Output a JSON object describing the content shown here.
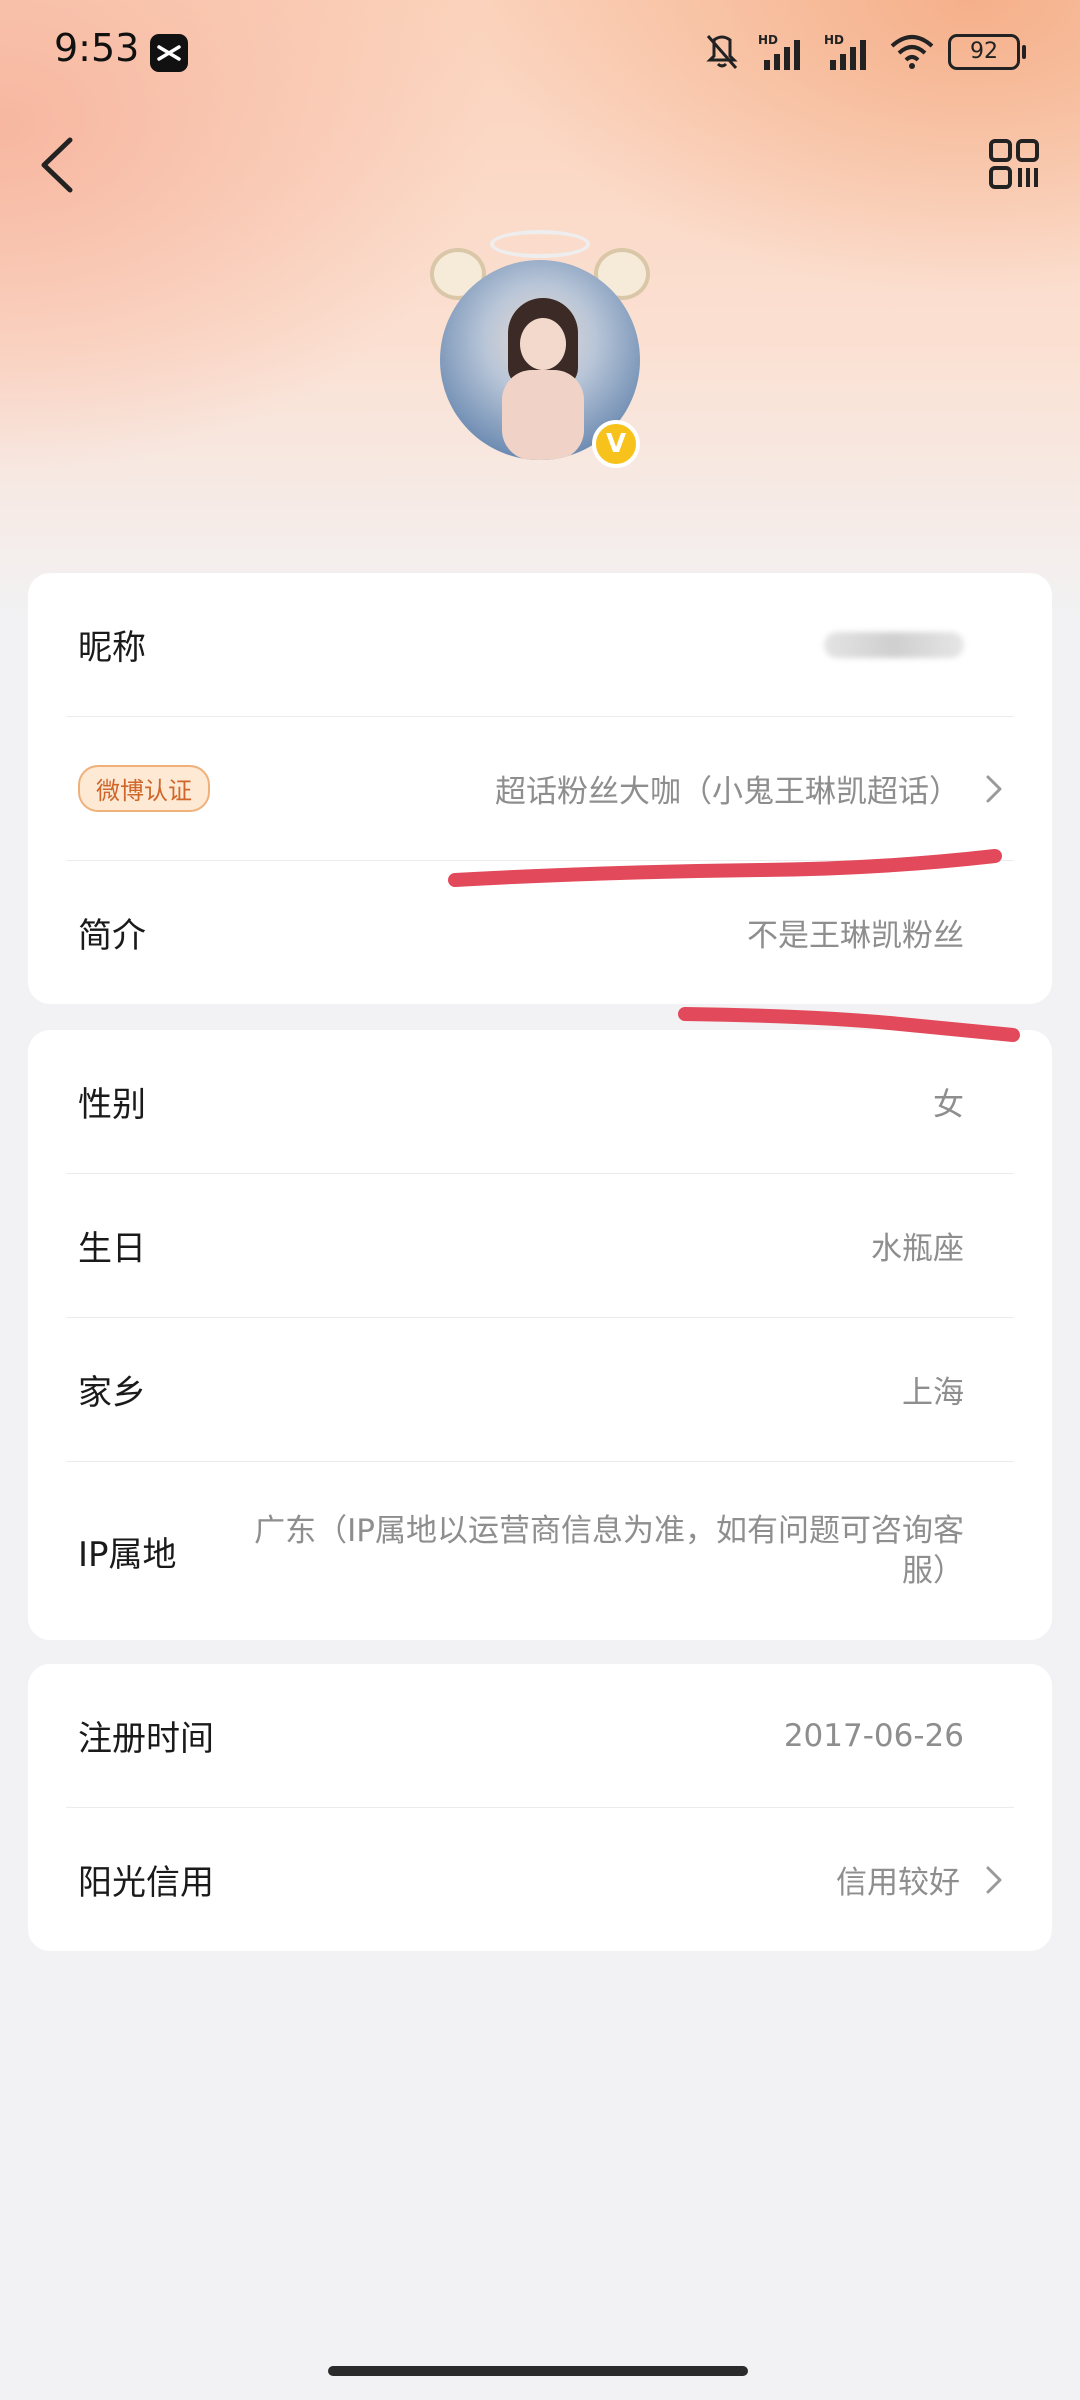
{
  "status_bar": {
    "time": "9:53",
    "battery": "92",
    "icons": [
      "capcut-icon",
      "mute-vibrate-icon",
      "hd-signal-icon",
      "hd-signal-icon",
      "wifi-icon",
      "battery-icon"
    ]
  },
  "nav": {
    "back_icon": "chevron-left-icon",
    "qr_icon": "qr-code-icon"
  },
  "profile": {
    "verified_badge": "V"
  },
  "card1": {
    "nickname_label": "昵称",
    "weibo_badge": "微博认证",
    "weibo_value": "超话粉丝大咖（小鬼王琳凯超话）",
    "bio_label": "简介",
    "bio_value": "不是王琳凯粉丝"
  },
  "card2": {
    "gender_label": "性别",
    "gender_value": "女",
    "birthday_label": "生日",
    "birthday_value": "水瓶座",
    "hometown_label": "家乡",
    "hometown_value": "上海",
    "ip_label": "IP属地",
    "ip_value": "广东（IP属地以运营商信息为准，如有问题可咨询客服）"
  },
  "card3": {
    "register_label": "注册时间",
    "register_value": "2017-06-26",
    "credit_label": "阳光信用",
    "credit_value": "信用较好"
  },
  "colors": {
    "annotation_red": "#e2495a",
    "badge_orange": "#d0662a",
    "verified_yellow": "#f7c21b"
  }
}
